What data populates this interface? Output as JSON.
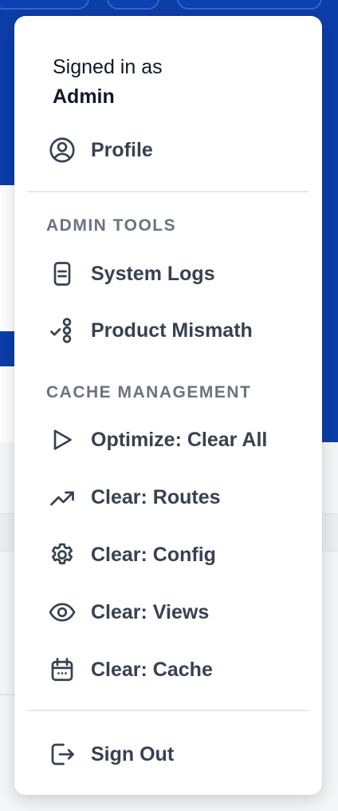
{
  "account": {
    "signed_in_label": "Signed in as",
    "username": "Admin",
    "profile_label": "Profile"
  },
  "admin_tools": {
    "heading": "ADMIN TOOLS",
    "items": [
      {
        "label": "System Logs",
        "icon": "document-icon"
      },
      {
        "label": "Product Mismath",
        "icon": "check-list-icon"
      }
    ]
  },
  "cache_management": {
    "heading": "CACHE MANAGEMENT",
    "items": [
      {
        "label": "Optimize: Clear All",
        "icon": "play-icon"
      },
      {
        "label": "Clear: Routes",
        "icon": "trending-up-icon"
      },
      {
        "label": "Clear: Config",
        "icon": "gear-icon"
      },
      {
        "label": "Clear: Views",
        "icon": "eye-icon"
      },
      {
        "label": "Clear: Cache",
        "icon": "calendar-icon"
      }
    ]
  },
  "sign_out_label": "Sign Out",
  "colors": {
    "header_blue": "#0b3ea8",
    "menu_text": "#374151",
    "section_text": "#6b7280"
  }
}
